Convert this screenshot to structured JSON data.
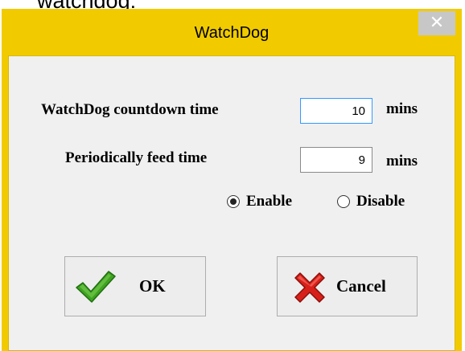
{
  "background_caption": "watchdog:",
  "window": {
    "title": "WatchDog",
    "close_symbol": "✕"
  },
  "form": {
    "countdown": {
      "label": "WatchDog countdown time",
      "value": "10",
      "unit": "mins"
    },
    "feed": {
      "label": "Periodically feed time",
      "value": "9",
      "unit": "mins"
    },
    "mode": {
      "options": [
        {
          "label": "Enable",
          "checked": true
        },
        {
          "label": "Disable",
          "checked": false
        }
      ]
    }
  },
  "buttons": {
    "ok": {
      "label": "OK",
      "icon": "checkmark-icon"
    },
    "cancel": {
      "label": "Cancel",
      "icon": "x-cross-icon"
    }
  },
  "colors": {
    "window_frame": "#f1cb00",
    "dialog_body": "#f0f0f0",
    "close_button": "#c7c7c7",
    "field_focus_border": "#3399ff",
    "check_green": "#3fa320",
    "cross_red": "#d8201a"
  }
}
